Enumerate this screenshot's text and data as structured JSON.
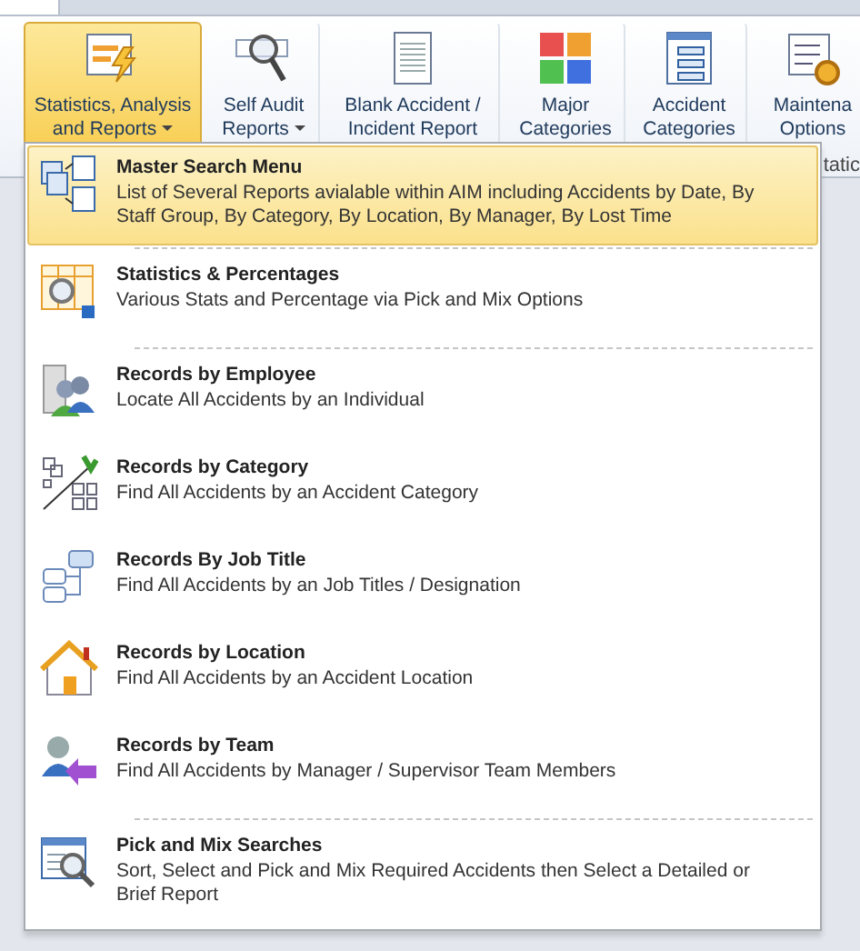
{
  "ribbon": {
    "buttons": [
      {
        "label": "Statistics, Analysis and Reports",
        "has_menu": true,
        "selected": true
      },
      {
        "label": "Self Audit Reports",
        "has_menu": true,
        "selected": false
      },
      {
        "label": "Blank Accident / Incident Report",
        "has_menu": false,
        "selected": false
      },
      {
        "label": "Major Categories",
        "has_menu": false,
        "selected": false
      },
      {
        "label": "Accident Categories",
        "has_menu": false,
        "selected": false
      },
      {
        "label": "Maintena Options",
        "has_menu": false,
        "selected": false
      }
    ],
    "group_label": "tatic"
  },
  "menu": {
    "items": [
      {
        "title": "Master Search Menu",
        "description": "List of Several Reports avialable within AIM including Accidents by Date, By Staff Group, By Category, By Location, By Manager, By Lost Time",
        "selected": true,
        "divider_above": false
      },
      {
        "title": "Statistics & Percentages",
        "description": "Various Stats and Percentage via Pick and Mix Options",
        "selected": false,
        "divider_above": true
      },
      {
        "title": "Records by Employee",
        "description": "Locate All Accidents by an Individual",
        "selected": false,
        "divider_above": true
      },
      {
        "title": "Records by Category",
        "description": "Find All Accidents by an Accident Category",
        "selected": false,
        "divider_above": false
      },
      {
        "title": "Records By Job Title",
        "description": "Find All Accidents by an Job Titles / Designation",
        "selected": false,
        "divider_above": false
      },
      {
        "title": "Records by Location",
        "description": "Find All Accidents by an Accident Location",
        "selected": false,
        "divider_above": false
      },
      {
        "title": "Records by Team",
        "description": "Find All Accidents by Manager / Supervisor Team Members",
        "selected": false,
        "divider_above": false
      },
      {
        "title": "Pick and Mix Searches",
        "description": "Sort, Select and Pick and Mix Required Accidents then Select a Detailed or Brief Report",
        "selected": false,
        "divider_above": true
      }
    ]
  }
}
